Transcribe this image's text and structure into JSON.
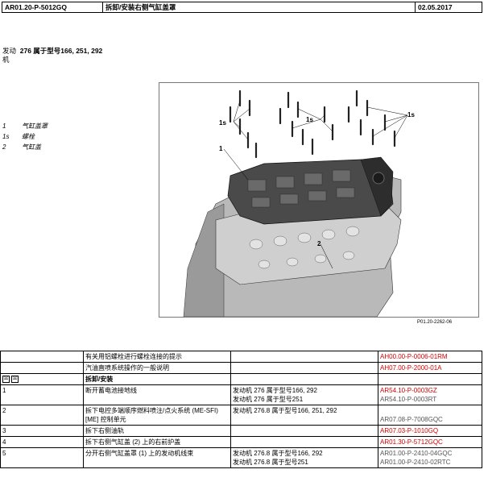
{
  "header": {
    "doc_id": "AR01.20-P-5012GQ",
    "title": "拆卸/安装右侧气缸盖罩",
    "date": "02.05.2017"
  },
  "intro": {
    "line1_prefix": "发动",
    "line1_bold": "276 属于型号166, 251, 292",
    "line2": "机"
  },
  "legend": [
    {
      "key": "1",
      "text": "气缸盖罩"
    },
    {
      "key": "1s",
      "text": "螺栓"
    },
    {
      "key": "2",
      "text": "气缸盖"
    }
  ],
  "figure": {
    "callouts": [
      "1s",
      "1s",
      "1s",
      "1",
      "2"
    ],
    "code": "P01.20-2262-06"
  },
  "steps": {
    "row_info1": {
      "text": "有关用铝螺栓进行螺栓连接的提示",
      "ref": "AH00.00-P-0006-01RM"
    },
    "row_info2": {
      "text": "汽油直喷系统操作的一般说明",
      "ref": "AH07.00-P-2000-01A"
    },
    "row_section": {
      "icons": [
        "⛝",
        "⛝"
      ],
      "text": "拆卸/安装"
    },
    "rows": [
      {
        "num": "1",
        "text": "断开蓄电池接地线",
        "sub": [
          {
            "cond": "发动机 276 属于型号166, 292",
            "ref": "AR54.10-P-0003GZ",
            "ref_style": "red"
          },
          {
            "cond": "发动机 276 属于型号251",
            "ref": "AR54.10-P-0003RT",
            "ref_style": "gray"
          }
        ]
      },
      {
        "num": "2",
        "text": "拆下电控多端顺序燃料喷注/点火系统 (ME-SFI) [ME] 控制单元",
        "sub": [
          {
            "cond": "发动机 276.8 属于型号166, 251, 292",
            "ref": "",
            "ref_style": "gray"
          },
          {
            "cond": "",
            "ref": "AR07.08-P-7008GQC",
            "ref_style": "gray"
          }
        ]
      },
      {
        "num": "3",
        "text": "拆下右侧油轨",
        "sub": [
          {
            "cond": "",
            "ref": "AR07.03-P-1010GQ",
            "ref_style": "red"
          }
        ]
      },
      {
        "num": "4",
        "text": "拆下右侧气缸盖 (2) 上的右前护盖",
        "sub": [
          {
            "cond": "",
            "ref": "AR01.30-P-5712GQC",
            "ref_style": "red"
          }
        ]
      },
      {
        "num": "5",
        "text": "分开右侧气缸盖罩 (1) 上的发动机线束",
        "sub": [
          {
            "cond": "发动机 276.8 属于型号166, 292",
            "ref": "AR01.00-P-2410-04GQC",
            "ref_style": "gray"
          },
          {
            "cond": "发动机 276.8 属于型号251",
            "ref": "AR01.00-P-2410-02RTC",
            "ref_style": "gray"
          }
        ]
      }
    ]
  }
}
